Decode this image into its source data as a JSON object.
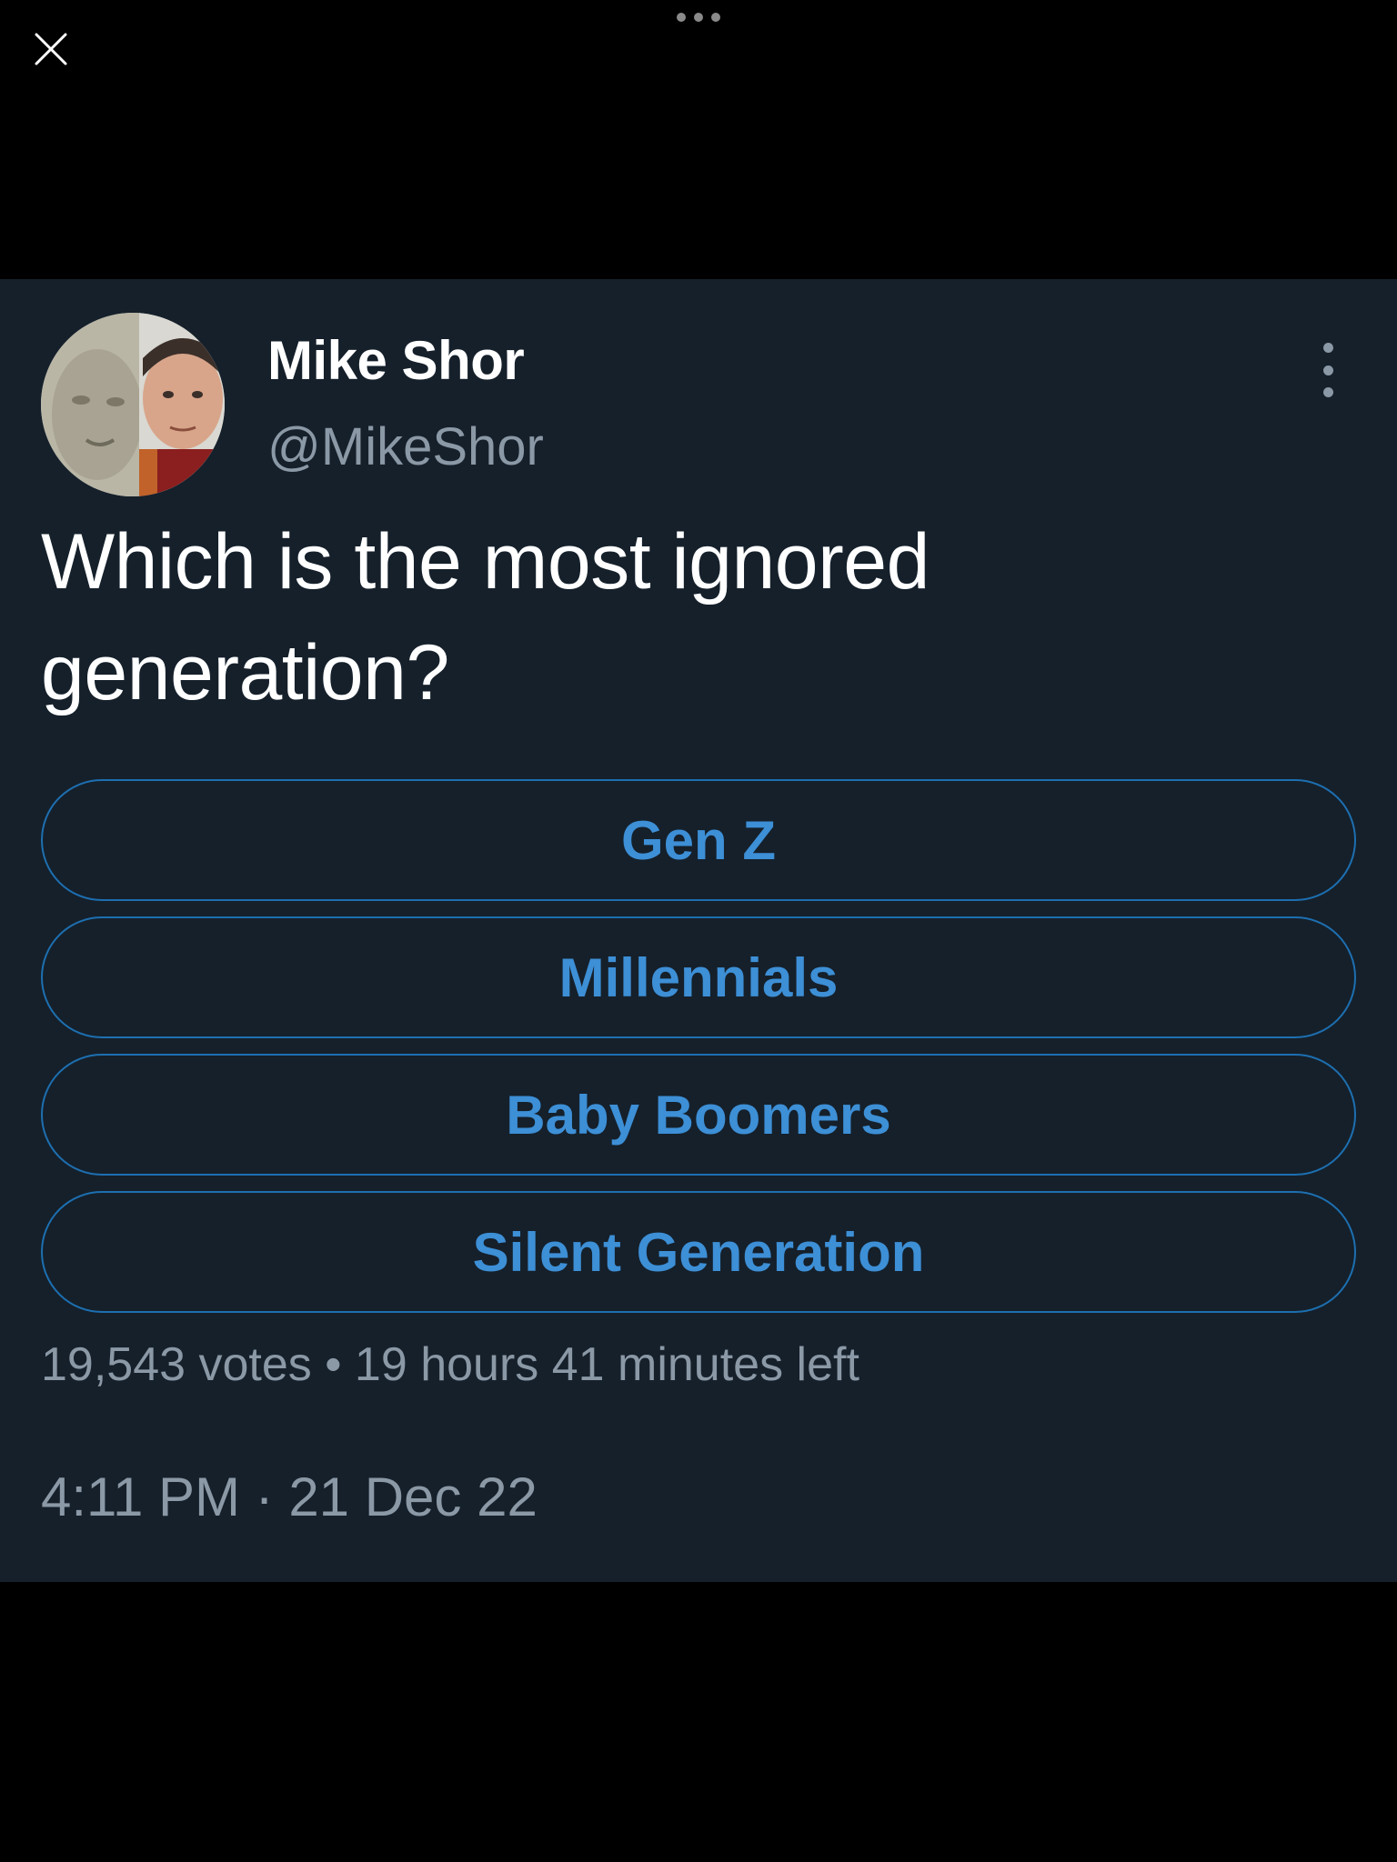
{
  "top_bar": {
    "close_icon": "close-icon",
    "menu_icon": "more-horizontal-icon"
  },
  "tweet": {
    "author": {
      "display_name": "Mike Shor",
      "handle": "@MikeShor"
    },
    "text": "Which is the most ignored generation?",
    "more_icon": "more-vertical-icon",
    "poll": {
      "options": [
        {
          "label": "Gen Z"
        },
        {
          "label": "Millennials"
        },
        {
          "label": "Baby Boomers"
        },
        {
          "label": "Silent Generation"
        }
      ],
      "votes": "19,543 votes",
      "separator": "•",
      "time_left": "19 hours 41 minutes left"
    },
    "timestamp": "4:11 PM · 21 Dec 22"
  },
  "colors": {
    "background": "#000000",
    "card": "#15202b",
    "accent": "#1d9bf0",
    "muted_text": "#8b98a5",
    "primary_text": "#ffffff"
  }
}
